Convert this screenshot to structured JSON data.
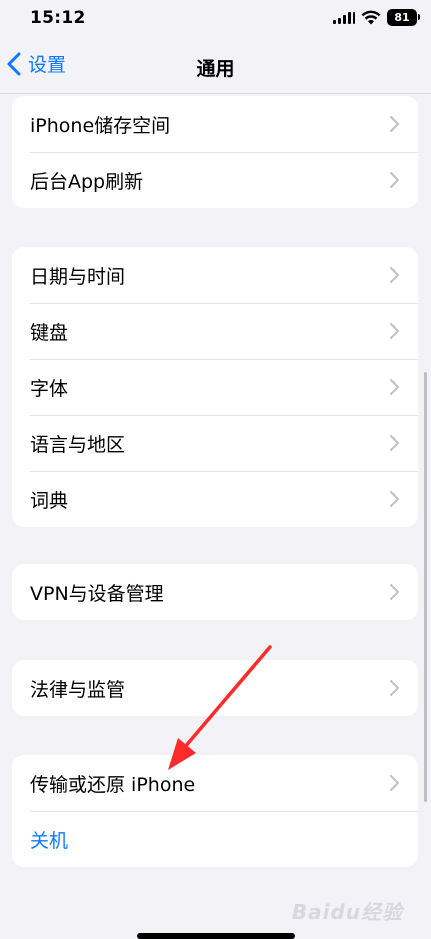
{
  "status": {
    "time": "15:12",
    "battery": "81"
  },
  "nav": {
    "back_label": "设置",
    "title": "通用"
  },
  "groups": [
    {
      "items": [
        {
          "label": "iPhone储存空间"
        },
        {
          "label": "后台App刷新"
        }
      ]
    },
    {
      "items": [
        {
          "label": "日期与时间"
        },
        {
          "label": "键盘"
        },
        {
          "label": "字体"
        },
        {
          "label": "语言与地区"
        },
        {
          "label": "词典"
        }
      ]
    },
    {
      "items": [
        {
          "label": "VPN与设备管理"
        }
      ]
    },
    {
      "items": [
        {
          "label": "法律与监管"
        }
      ]
    },
    {
      "items": [
        {
          "label": "传输或还原 iPhone"
        },
        {
          "label": "关机"
        }
      ]
    }
  ],
  "colors": {
    "accent": "#0a7aff",
    "annotation_arrow": "#ff2a2a",
    "background": "#f2f2f7"
  },
  "watermark": "Baidu经验"
}
